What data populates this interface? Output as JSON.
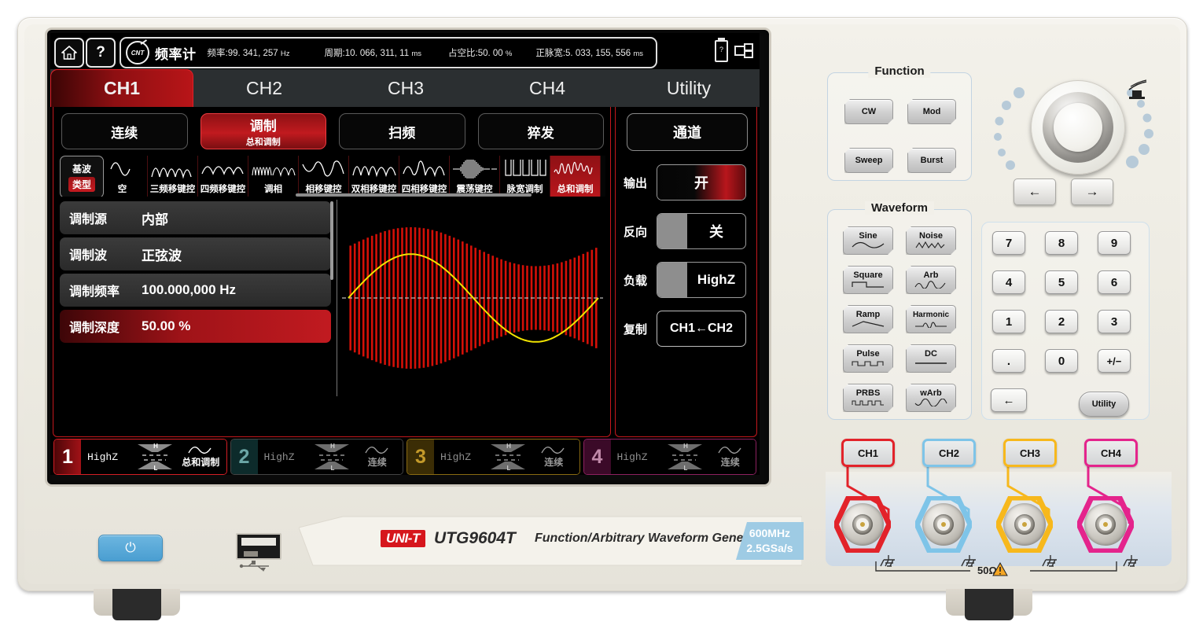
{
  "device": {
    "brand": "UNI-T",
    "model": "UTG9604T",
    "subtitle": "Function/Arbitrary Waveform Generator",
    "spec_line1": "600MHz",
    "spec_line2": "2.5GSa/s",
    "ohm_label": "50Ω"
  },
  "screen": {
    "statusbar": {
      "home_icon": "home-icon",
      "help_label": "?",
      "counter_icon": "CNT",
      "counter_title": "频率计",
      "fields": [
        {
          "label": "频率:",
          "value": "99. 341, 257",
          "unit": "Hz"
        },
        {
          "label": "周期:",
          "value": "10. 066, 311, 11",
          "unit": "ms"
        },
        {
          "label": "占空比:",
          "value": "50. 00",
          "unit": "%"
        },
        {
          "label": "正脉宽:",
          "value": "5. 033, 155, 556",
          "unit": "ms"
        }
      ],
      "sys_icons": [
        "usb-drive-icon",
        "network-icon"
      ]
    },
    "tabs": [
      {
        "label": "CH1",
        "active": true
      },
      {
        "label": "CH2",
        "active": false
      },
      {
        "label": "CH3",
        "active": false
      },
      {
        "label": "CH4",
        "active": false
      },
      {
        "label": "Utility",
        "active": false
      }
    ],
    "modes": [
      {
        "label": "连续",
        "sub": "",
        "active": false
      },
      {
        "label": "调制",
        "sub": "总和调制",
        "active": true
      },
      {
        "label": "扫频",
        "sub": "",
        "active": false
      },
      {
        "label": "猝发",
        "sub": "",
        "active": false
      }
    ],
    "channel_button": "通道",
    "wave_type_button": {
      "line1": "基波",
      "line2": "类型"
    },
    "wave_types": [
      {
        "label": "空",
        "glyph": "sine-partial-icon",
        "selected": false
      },
      {
        "label": "三频移键控",
        "glyph": "fsk3-icon",
        "selected": false
      },
      {
        "label": "四频移键控",
        "glyph": "fsk4-icon",
        "selected": false
      },
      {
        "label": "调相",
        "glyph": "pm-icon",
        "selected": false
      },
      {
        "label": "相移键控",
        "glyph": "psk-icon",
        "selected": false
      },
      {
        "label": "双相移键控",
        "glyph": "bpsk-icon",
        "selected": false
      },
      {
        "label": "四相移键控",
        "glyph": "qpsk-icon",
        "selected": false
      },
      {
        "label": "震荡键控",
        "glyph": "osk-icon",
        "selected": false
      },
      {
        "label": "脉宽调制",
        "glyph": "pwm-icon",
        "selected": false
      },
      {
        "label": "总和调制",
        "glyph": "sum-icon",
        "selected": true
      }
    ],
    "parameters": [
      {
        "key": "调制源",
        "value": "内部",
        "selected": false
      },
      {
        "key": "调制波",
        "value": "正弦波",
        "selected": false
      },
      {
        "key": "调制频率",
        "value": "100.000,000 Hz",
        "selected": false
      },
      {
        "key": "调制深度",
        "value": "50.00 %",
        "selected": true
      }
    ],
    "side_controls": [
      {
        "key": "输出",
        "value": "开",
        "type": "toggle-on"
      },
      {
        "key": "反向",
        "value": "关",
        "type": "toggle-off"
      },
      {
        "key": "负载",
        "value": "HighZ",
        "type": "toggle-off"
      },
      {
        "key": "复制",
        "value": "CH1←CH2",
        "type": "button"
      }
    ],
    "channel_bar": [
      {
        "num": "1",
        "load": "HighZ",
        "mode": "总和调制",
        "high": "H",
        "low": "L",
        "color": "#d41e24",
        "active": true
      },
      {
        "num": "2",
        "load": "HighZ",
        "mode": "连续",
        "high": "H",
        "low": "L",
        "color": "#1c6b6b",
        "active": false
      },
      {
        "num": "3",
        "load": "HighZ",
        "mode": "连续",
        "high": "H",
        "low": "L",
        "color": "#9d7a16",
        "active": false
      },
      {
        "num": "4",
        "load": "HighZ",
        "mode": "连续",
        "high": "H",
        "low": "L",
        "color": "#8d2160",
        "active": false
      }
    ],
    "plot": {
      "carrier_color": "#d41007",
      "modulation_color": "#f2e400",
      "baseline_color": "#bdbdbd"
    }
  },
  "front_panel": {
    "function_group": {
      "title": "Function",
      "buttons": [
        "CW",
        "Mod",
        "Sweep",
        "Burst"
      ]
    },
    "waveform_group": {
      "title": "Waveform",
      "buttons": [
        {
          "label": "Sine",
          "glyph": "sine-icon"
        },
        {
          "label": "Noise",
          "glyph": "noise-icon"
        },
        {
          "label": "Square",
          "glyph": "square-icon"
        },
        {
          "label": "Arb",
          "glyph": "arb-icon"
        },
        {
          "label": "Ramp",
          "glyph": "ramp-icon"
        },
        {
          "label": "Harmonic",
          "glyph": "harmonic-icon"
        },
        {
          "label": "Pulse",
          "glyph": "pulse-icon"
        },
        {
          "label": "DC",
          "glyph": "dc-icon"
        },
        {
          "label": "PRBS",
          "glyph": "prbs-icon"
        },
        {
          "label": "wArb",
          "glyph": "warb-icon"
        }
      ]
    },
    "keypad": [
      "7",
      "8",
      "9",
      "4",
      "5",
      "6",
      "1",
      "2",
      "3",
      ".",
      "0",
      "+/−"
    ],
    "backspace_label": "←",
    "utility_label": "Utility",
    "arrow_left": "←",
    "arrow_right": "→",
    "knob_name": "rotary-knob",
    "trigger_icon": "trigger-out-icon",
    "channel_buttons": [
      "CH1",
      "CH2",
      "CH3",
      "CH4"
    ],
    "channel_colors": [
      "#e2232a",
      "#7ec4e8",
      "#f7b81c",
      "#e4248c"
    ],
    "power_icon": "⏻",
    "usb_label": "usb-port"
  }
}
